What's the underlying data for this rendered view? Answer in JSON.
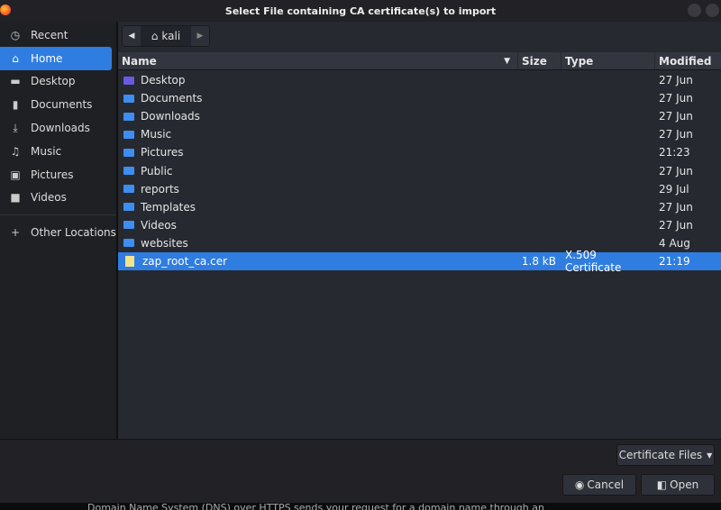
{
  "window": {
    "title": "Select File containing CA certificate(s) to import"
  },
  "sidebar": {
    "items": [
      {
        "label": "Recent",
        "icon": "clock-icon",
        "glyph": "◷"
      },
      {
        "label": "Home",
        "icon": "home-icon",
        "glyph": "⌂",
        "active": true
      },
      {
        "label": "Desktop",
        "icon": "desktop-icon",
        "glyph": "▬"
      },
      {
        "label": "Documents",
        "icon": "document-icon",
        "glyph": "▮"
      },
      {
        "label": "Downloads",
        "icon": "download-icon",
        "glyph": "⤓"
      },
      {
        "label": "Music",
        "icon": "music-icon",
        "glyph": "♫"
      },
      {
        "label": "Pictures",
        "icon": "picture-icon",
        "glyph": "▣"
      },
      {
        "label": "Videos",
        "icon": "video-icon",
        "glyph": "■"
      }
    ],
    "other": {
      "label": "Other Locations",
      "icon": "plus-icon",
      "glyph": "+"
    }
  },
  "pathbar": {
    "current": "kali"
  },
  "columns": {
    "name": "Name",
    "size": "Size",
    "type": "Type",
    "modified": "Modified"
  },
  "files": [
    {
      "name": "Desktop",
      "size": "",
      "type": "",
      "modified": "27 Jun",
      "kind": "folder",
      "color": "#6a5ae0"
    },
    {
      "name": "Documents",
      "size": "",
      "type": "",
      "modified": "27 Jun",
      "kind": "folder"
    },
    {
      "name": "Downloads",
      "size": "",
      "type": "",
      "modified": "27 Jun",
      "kind": "folder"
    },
    {
      "name": "Music",
      "size": "",
      "type": "",
      "modified": "27 Jun",
      "kind": "folder"
    },
    {
      "name": "Pictures",
      "size": "",
      "type": "",
      "modified": "21:23",
      "kind": "folder"
    },
    {
      "name": "Public",
      "size": "",
      "type": "",
      "modified": "27 Jun",
      "kind": "folder"
    },
    {
      "name": "reports",
      "size": "",
      "type": "",
      "modified": "29 Jul",
      "kind": "folder"
    },
    {
      "name": "Templates",
      "size": "",
      "type": "",
      "modified": "27 Jun",
      "kind": "folder"
    },
    {
      "name": "Videos",
      "size": "",
      "type": "",
      "modified": "27 Jun",
      "kind": "folder"
    },
    {
      "name": "websites",
      "size": "",
      "type": "",
      "modified": "4 Aug",
      "kind": "folder"
    },
    {
      "name": "zap_root_ca.cer",
      "size": "1.8 kB",
      "type": "X.509 Certificate",
      "modified": "21:19",
      "kind": "file",
      "selected": true
    }
  ],
  "filter": {
    "label": "Certificate Files"
  },
  "buttons": {
    "cancel": "Cancel",
    "open": "Open"
  },
  "background_text": "Domain Name System (DNS) over HTTPS sends your request for a domain name through an",
  "colors": {
    "accent": "#2f7de0"
  }
}
